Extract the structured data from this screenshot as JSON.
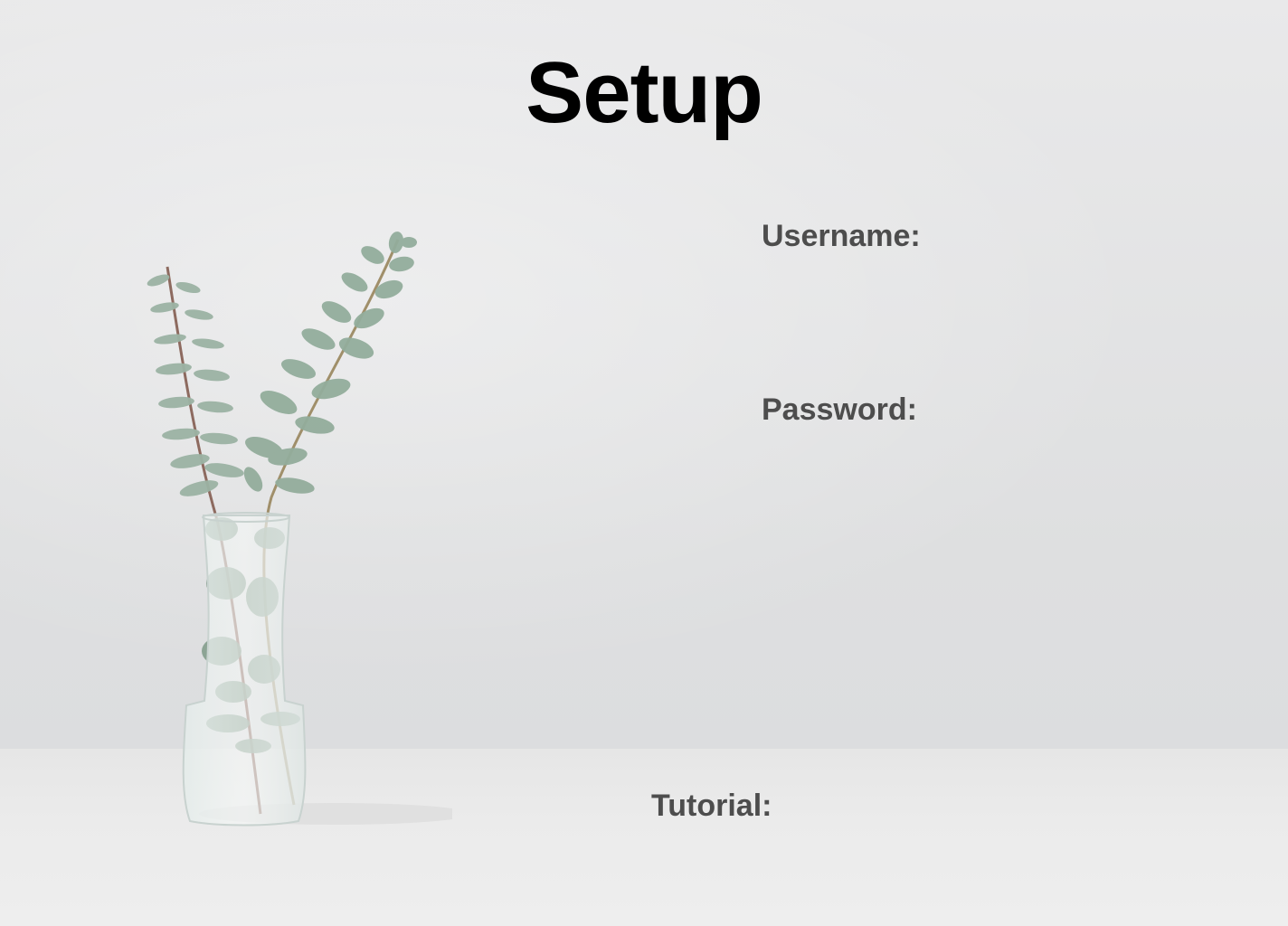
{
  "page": {
    "title": "Setup"
  },
  "form": {
    "username_label": "Username:",
    "password_label": "Password:",
    "tutorial_label": "Tutorial:",
    "username_value": "",
    "password_value": "",
    "tutorial_value": ""
  },
  "decor": {
    "image": "eucalyptus-vase-illustration",
    "background_color": "#e0e0e1",
    "title_color": "#000000",
    "label_color": "#4d4d4d",
    "leaf_color": "#8aa594"
  }
}
